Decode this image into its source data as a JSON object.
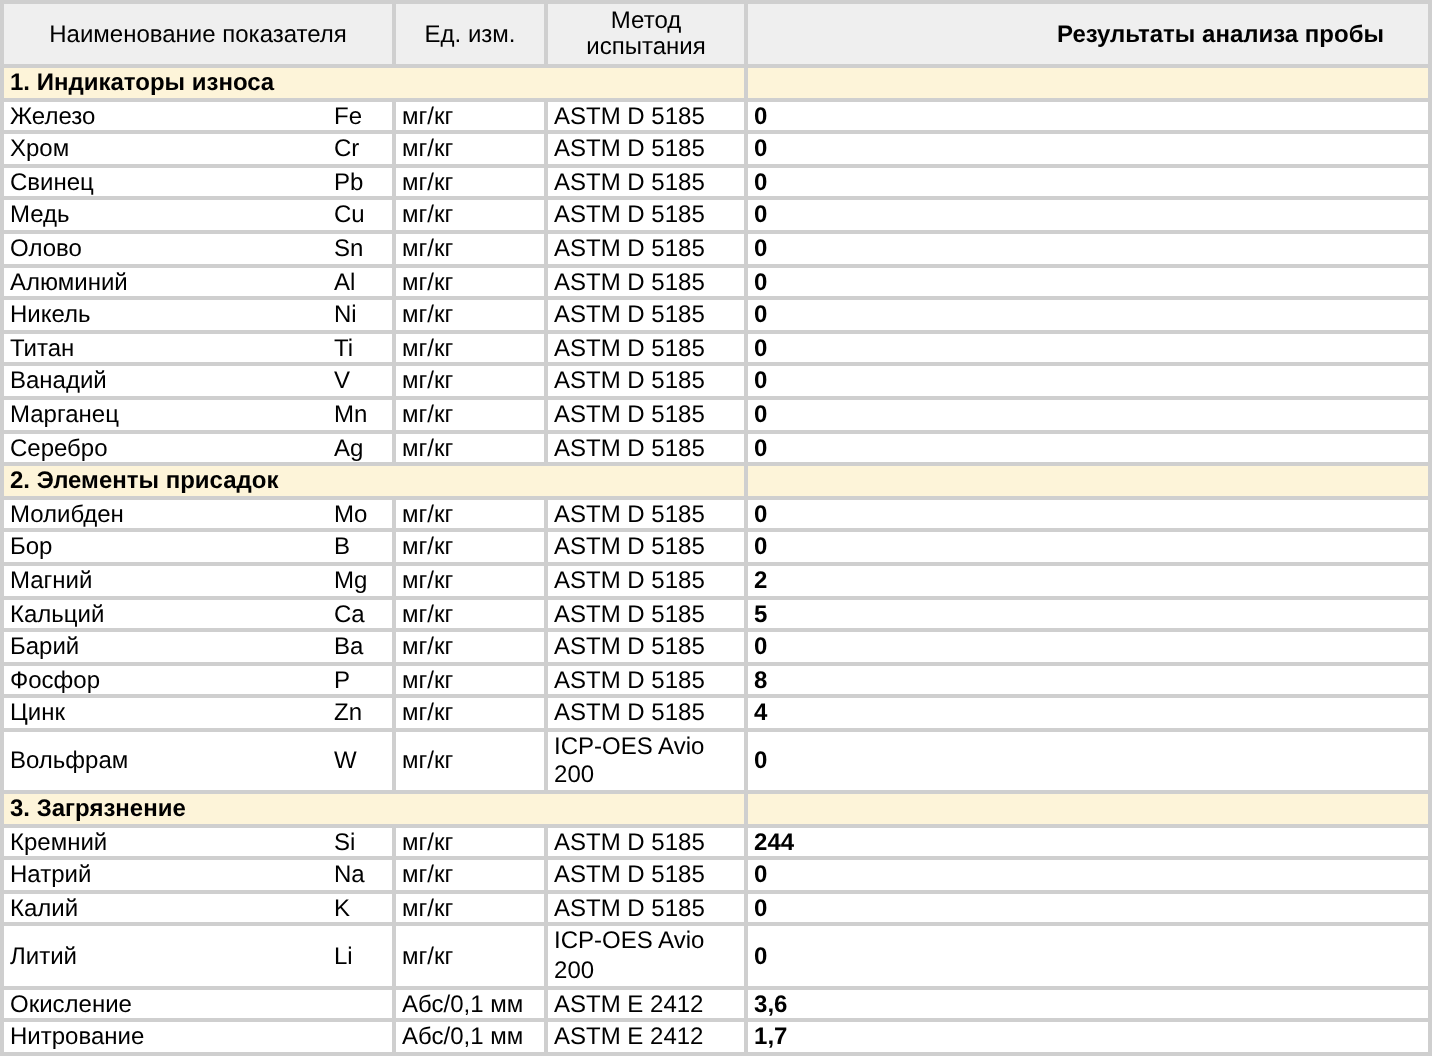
{
  "table": {
    "columns": [
      {
        "label": "Наименование показателя"
      },
      {
        "label": "Ед. изм."
      },
      {
        "label": "Метод испытания"
      },
      {
        "label": "Результаты анализа пробы"
      }
    ],
    "sections": [
      {
        "title": "1. Индикаторы износа",
        "rows": [
          {
            "name": "Железо",
            "symbol": "Fe",
            "unit": "мг/кг",
            "method": "ASTM D 5185",
            "result": "0"
          },
          {
            "name": "Хром",
            "symbol": "Cr",
            "unit": "мг/кг",
            "method": "ASTM D 5185",
            "result": "0"
          },
          {
            "name": "Свинец",
            "symbol": "Pb",
            "unit": "мг/кг",
            "method": "ASTM D 5185",
            "result": "0"
          },
          {
            "name": "Медь",
            "symbol": "Cu",
            "unit": "мг/кг",
            "method": "ASTM D 5185",
            "result": "0"
          },
          {
            "name": "Олово",
            "symbol": "Sn",
            "unit": "мг/кг",
            "method": "ASTM D 5185",
            "result": "0"
          },
          {
            "name": "Алюминий",
            "symbol": "Al",
            "unit": "мг/кг",
            "method": "ASTM D 5185",
            "result": "0"
          },
          {
            "name": "Никель",
            "symbol": "Ni",
            "unit": "мг/кг",
            "method": "ASTM D 5185",
            "result": "0"
          },
          {
            "name": "Титан",
            "symbol": "Ti",
            "unit": "мг/кг",
            "method": "ASTM D 5185",
            "result": "0"
          },
          {
            "name": "Ванадий",
            "symbol": "V",
            "unit": "мг/кг",
            "method": "ASTM D 5185",
            "result": "0"
          },
          {
            "name": "Марганец",
            "symbol": "Mn",
            "unit": "мг/кг",
            "method": "ASTM D 5185",
            "result": "0"
          },
          {
            "name": "Серебро",
            "symbol": "Ag",
            "unit": "мг/кг",
            "method": "ASTM D 5185",
            "result": "0"
          }
        ]
      },
      {
        "title": "2. Элементы присадок",
        "rows": [
          {
            "name": "Молибден",
            "symbol": "Mo",
            "unit": "мг/кг",
            "method": "ASTM D 5185",
            "result": "0"
          },
          {
            "name": "Бор",
            "symbol": "B",
            "unit": "мг/кг",
            "method": "ASTM D 5185",
            "result": "0"
          },
          {
            "name": "Магний",
            "symbol": "Mg",
            "unit": "мг/кг",
            "method": "ASTM D 5185",
            "result": "2"
          },
          {
            "name": "Кальций",
            "symbol": "Ca",
            "unit": "мг/кг",
            "method": "ASTM D 5185",
            "result": "5"
          },
          {
            "name": "Барий",
            "symbol": "Ba",
            "unit": "мг/кг",
            "method": "ASTM D 5185",
            "result": "0"
          },
          {
            "name": "Фосфор",
            "symbol": "P",
            "unit": "мг/кг",
            "method": "ASTM D 5185",
            "result": "8"
          },
          {
            "name": "Цинк",
            "symbol": "Zn",
            "unit": "мг/кг",
            "method": "ASTM D 5185",
            "result": "4"
          },
          {
            "name": "Вольфрам",
            "symbol": "W",
            "unit": "мг/кг",
            "method": "ICP-OES Avio 200",
            "result": "0"
          }
        ]
      },
      {
        "title": "3. Загрязнение",
        "rows": [
          {
            "name": "Кремний",
            "symbol": "Si",
            "unit": "мг/кг",
            "method": "ASTM D 5185",
            "result": "244"
          },
          {
            "name": "Натрий",
            "symbol": "Na",
            "unit": "мг/кг",
            "method": "ASTM D 5185",
            "result": "0"
          },
          {
            "name": "Калий",
            "symbol": "K",
            "unit": "мг/кг",
            "method": "ASTM D 5185",
            "result": "0"
          },
          {
            "name": "Литий",
            "symbol": "Li",
            "unit": "мг/кг",
            "method": "ICP-OES Avio 200",
            "result": "0"
          },
          {
            "name": "Окисление",
            "unit": "Абс/0,1 мм",
            "method": "ASTM E 2412",
            "result": "3,6"
          },
          {
            "name": "Нитрование",
            "unit": "Абс/0,1 мм",
            "method": "ASTM E 2412",
            "result": "1,7"
          }
        ]
      }
    ]
  }
}
